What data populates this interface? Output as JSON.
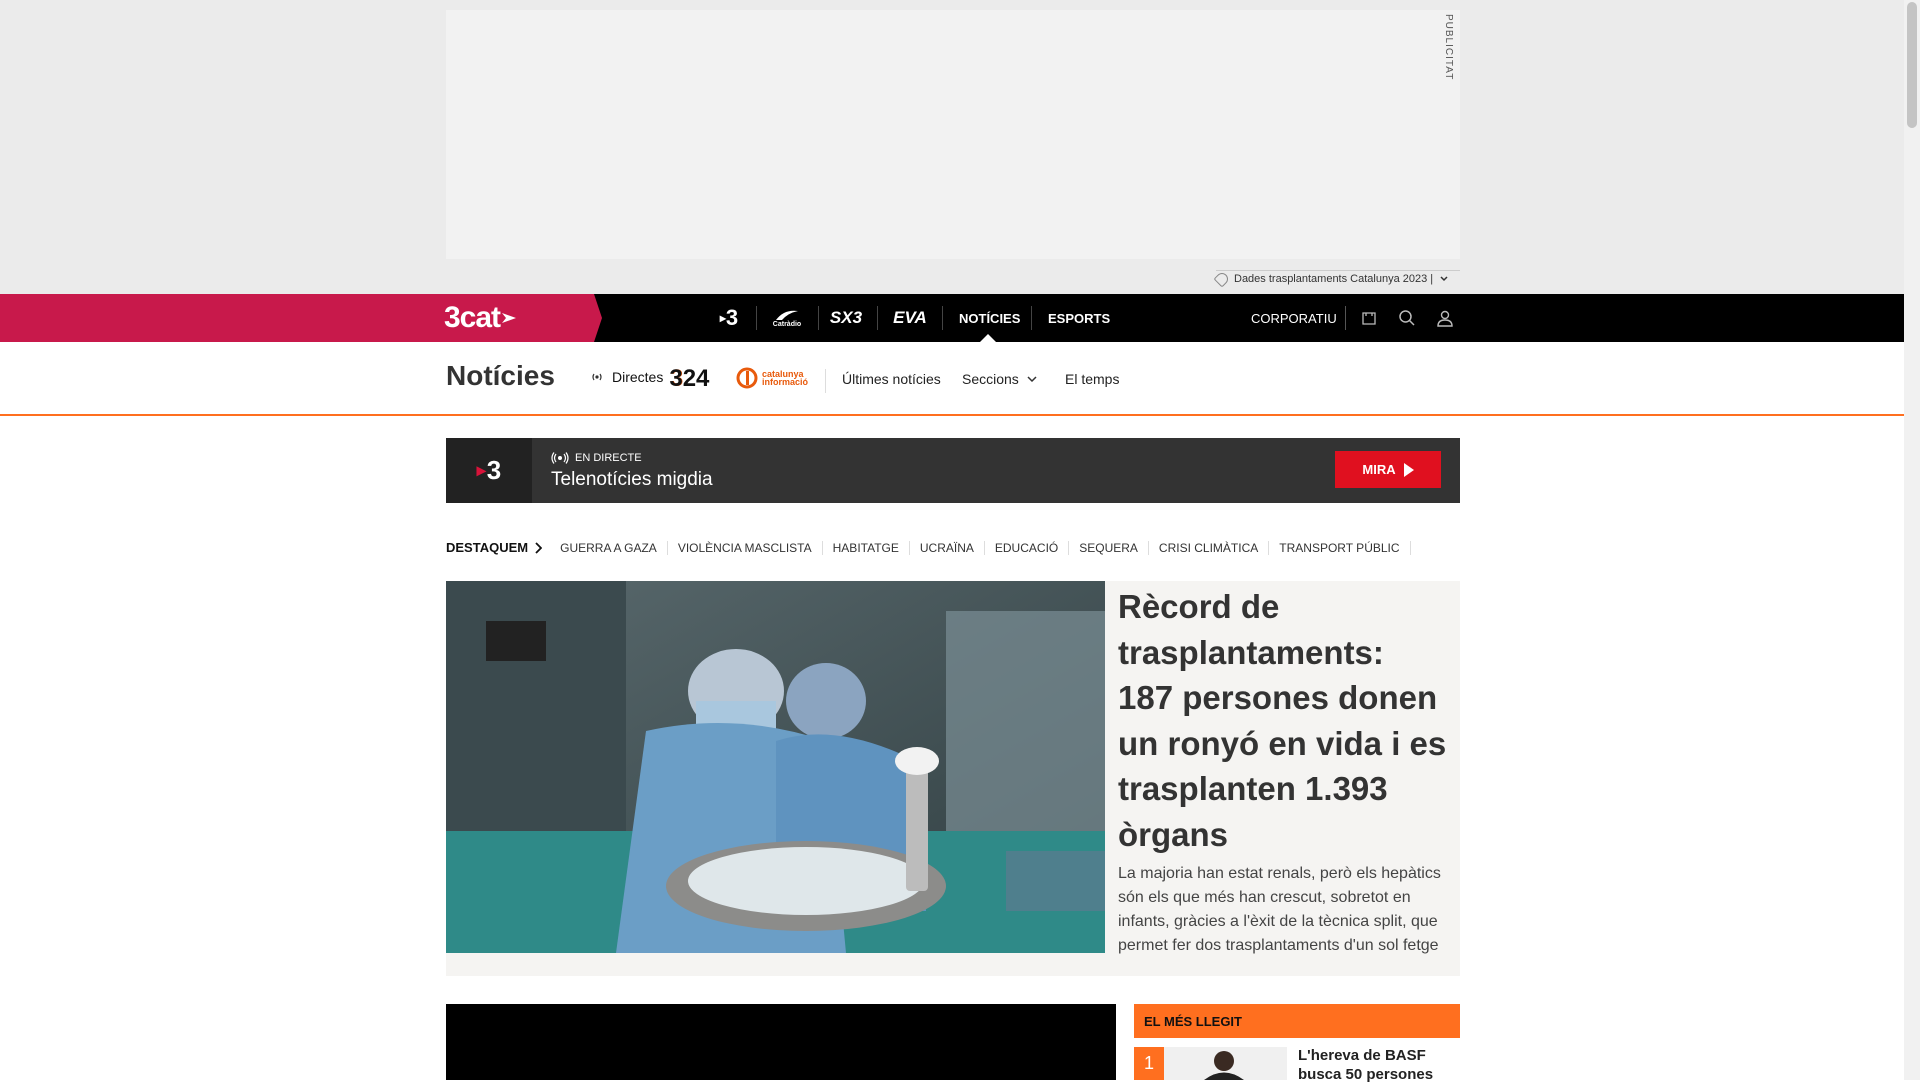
{
  "ad": {
    "label": "PUBLICITAT"
  },
  "tagline": {
    "text": "Dades trasplantaments Catalunya 2023 |",
    "chevron_icon": "chevron-down-icon"
  },
  "topnav": {
    "brand": "3cat",
    "channels": [
      "3",
      "Catràdio",
      "SX3",
      "EVA"
    ],
    "links": [
      {
        "label": "NOTÍCIES",
        "active": true
      },
      {
        "label": "ESPORTS",
        "active": false
      }
    ],
    "corporatiu": "CORPORATIU",
    "icons": [
      "cart-icon",
      "search-icon",
      "user-icon"
    ],
    "brand_color": "#c8194b"
  },
  "section": {
    "title": "Notícies",
    "directes": "Directes",
    "logo_324": "324",
    "logo_ci": "catalunya informació",
    "links": [
      "Últimes notícies",
      "Seccions",
      "El temps"
    ],
    "accent_color": "#ff6f1f"
  },
  "live": {
    "channel": "3",
    "status": "EN DIRECTE",
    "program": "Telenotícies migdia",
    "button": "MIRA",
    "button_color": "#e0101f"
  },
  "destaquem": {
    "label": "DESTAQUEM",
    "items": [
      "GUERRA A GAZA",
      "VIOLÈNCIA MASCLISTA",
      "HABITATGE",
      "UCRAÏNA",
      "EDUCACIÓ",
      "SEQUERA",
      "CRISI CLIMÀTICA",
      "TRANSPORT PÚBLIC"
    ]
  },
  "hero": {
    "title": "Rècord de trasplantaments: 187 persones donen un ronyó en vida i es trasplanten 1.393 òrgans",
    "lead": "La majoria han estat renals, però els hepàtics són els que més han crescut, sobretot en infants, gràcies a l'èxit de la tècnica split, que permet fer dos trasplantaments d'un sol fetge"
  },
  "mes_llegit": {
    "heading": "EL MÉS LLEGIT",
    "items": [
      {
        "rank": "1",
        "title": "L'hereva de BASF busca 50 persones"
      }
    ]
  }
}
